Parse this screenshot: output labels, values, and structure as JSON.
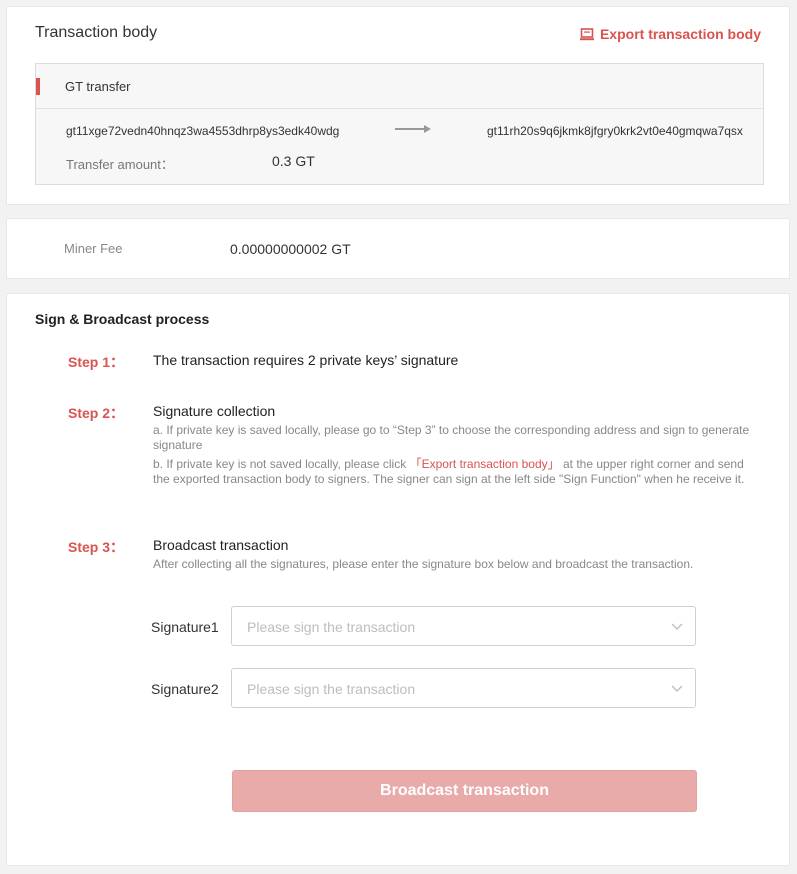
{
  "tx_body": {
    "title": "Transaction body",
    "export_label": "Export transaction body",
    "transfer": {
      "label": "GT transfer",
      "from": "gt11xge72vedn40hnqz3wa4553dhrp8ys3edk40wdg",
      "to": "gt11rh20s9q6jkmk8jfgry0krk2vt0e40gmqwa7qsx",
      "amount_label": "Transfer amount：",
      "amount_value": "0.3 GT"
    }
  },
  "fee": {
    "label": "Miner Fee",
    "value": "0.00000000002 GT"
  },
  "sign": {
    "title": "Sign & Broadcast process",
    "steps": [
      {
        "label": "Step 1：",
        "heading": "The transaction requires 2 private keys’ signature"
      },
      {
        "label": "Step 2：",
        "heading": "Signature collection",
        "desc_a": "a. If private key is saved locally, please go to “Step 3” to choose the corresponding address and sign to generate signature",
        "desc_b_pre": "b. If private key is not saved locally, please click ",
        "desc_b_link": "「Export transaction body」",
        "desc_b_post": " at the upper right corner and send the exported transaction body to signers. The signer can sign at the left side \"Sign Function\" when he receive it."
      },
      {
        "label": "Step 3：",
        "heading": "Broadcast transaction",
        "desc": "After collecting all the signatures, please enter the signature box below and broadcast the transaction."
      }
    ],
    "signatures": [
      {
        "label": "Signature1",
        "placeholder": "Please sign the transaction"
      },
      {
        "label": "Signature2",
        "placeholder": "Please sign the transaction"
      }
    ],
    "broadcast_label": "Broadcast transaction"
  },
  "colors": {
    "accent": "#d9534f",
    "button_disabled": "#e9aaaa",
    "background": "#f2f2f2"
  },
  "icons": {
    "export": "laptop-icon",
    "arrow": "arrow-right-icon",
    "select": "chevron-down-icon"
  }
}
